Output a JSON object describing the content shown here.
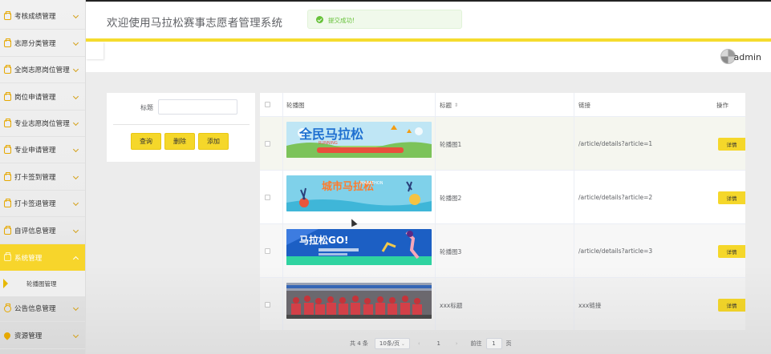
{
  "header": {
    "title": "欢迎使用马拉松赛事志愿者管理系统",
    "user": "admin"
  },
  "toast": {
    "message": "提交成功!"
  },
  "sidebar": {
    "items": [
      {
        "label": "考核成绩管理"
      },
      {
        "label": "志愿分类管理"
      },
      {
        "label": "全岗志愿岗位管理"
      },
      {
        "label": "岗位申请管理"
      },
      {
        "label": "专业志愿岗位管理"
      },
      {
        "label": "专业申请管理"
      },
      {
        "label": "打卡签到管理"
      },
      {
        "label": "打卡签退管理"
      },
      {
        "label": "自评信息管理"
      },
      {
        "label": "系统管理"
      },
      {
        "label": "公告信息管理"
      },
      {
        "label": "资源管理"
      }
    ],
    "active_index": 9,
    "submenu": {
      "label": "轮播图管理"
    }
  },
  "search": {
    "label": "标题",
    "value": "",
    "buttons": {
      "query": "查询",
      "delete": "删除",
      "add": "添加"
    }
  },
  "table": {
    "headers": {
      "image": "轮播图",
      "title": "标题",
      "link": "链接",
      "action": "操作"
    },
    "rows": [
      {
        "image": "banner-1",
        "title": "轮播图1",
        "link": "/article/details?article=1",
        "action": "详情"
      },
      {
        "image": "banner-2",
        "title": "轮播图2",
        "link": "/article/details?article=2",
        "action": "详情"
      },
      {
        "image": "banner-3",
        "title": "轮播图3",
        "link": "/article/details?article=3",
        "action": "详情"
      },
      {
        "image": "photo-runners",
        "title": "xxx标题",
        "link": "xxx链接",
        "action": "详情"
      }
    ]
  },
  "banners": {
    "b1_text": "全民马拉松",
    "b1_sub": "RUNNING",
    "b2_text": "城市马拉松",
    "b2_sub": "MARATHON",
    "b3_text": "马拉松GO!"
  },
  "pagination": {
    "total": "共 4 条",
    "page_size": "10条/页",
    "current_page": "1",
    "goto_label": "前往",
    "goto_value": "1",
    "page_suffix": "页"
  },
  "colors": {
    "accent": "#f5d72a",
    "success": "#67c23a",
    "active_menu": "#f7d52b"
  }
}
